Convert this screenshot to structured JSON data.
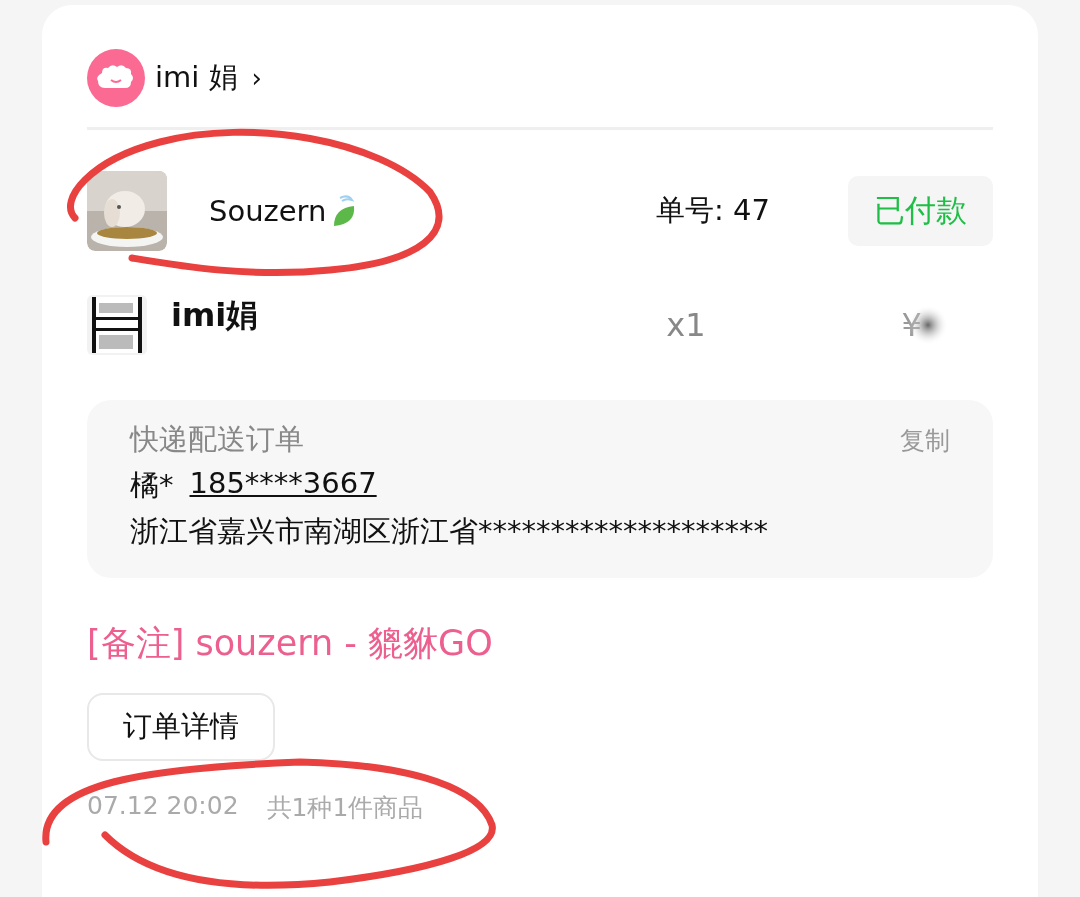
{
  "shop": {
    "name": "imi 娟",
    "chevron": "›"
  },
  "order": {
    "buyer": "Souzern",
    "number_label": "单号: 47",
    "status": "已付款"
  },
  "item": {
    "title": "imi娟",
    "quantity": "x1",
    "price": "¥"
  },
  "delivery": {
    "title": "快递配送订单",
    "copy": "复制",
    "recipient": "橘*",
    "phone": "185****3667",
    "address": "浙江省嘉兴市南湖区浙江省********************"
  },
  "note": "[备注] souzern - 貔貅GO",
  "detail_button": "订单详情",
  "footer": {
    "time": "07.12 20:02",
    "summary": "共1种1件商品"
  }
}
